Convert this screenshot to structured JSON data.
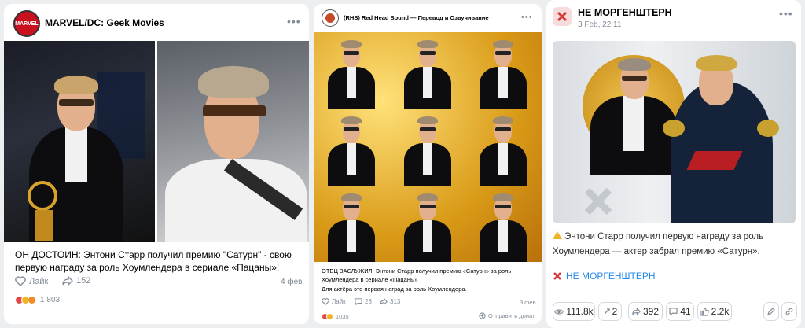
{
  "post1": {
    "group": "MARVEL/DC: Geek Movies",
    "avatar_text": "MARVEL",
    "text": "ОН ДОСТОИН: Энтони Старр получил премию \"Сатурн\" - свою первую награду за роль Хоумлендера в сериале «Пацаны»!",
    "like_label": "Лайк",
    "shares": "152",
    "date": "4 фев",
    "reactions_count": "1 803",
    "icons": [
      "more-icon",
      "like-icon",
      "share-icon",
      "reaction-heart",
      "reaction-emoji"
    ]
  },
  "post2": {
    "group": "(RHS) Red Head Sound — Перевод и Озвучивание",
    "text_line1": "ОТЕЦ ЗАСЛУЖИЛ: Энтони Старр получил премию «Сатурн» за роль Хоумлендера в сериале «Пацаны»",
    "text_line2": "Для актёра это первая наград за роль Хоумлендера.",
    "like_label": "Лайк",
    "comments": "28",
    "shares": "313",
    "date": "3 фев",
    "reactions_count": "1035",
    "donate_label": "Отправить донат"
  },
  "post3": {
    "group": "НЕ МОРГЕНШТЕРН",
    "date": "3 Feb, 22:11",
    "text": "Энтони Старр получил первую награду за роль Хоумлендера — актер забрал премию «Сатурн».",
    "link_label": "НЕ МОРГЕНШТЕРН",
    "views": "111.8k",
    "reposts_small": "2",
    "shares": "392",
    "comments": "41",
    "likes": "2.2k",
    "accent": "#2688eb"
  }
}
